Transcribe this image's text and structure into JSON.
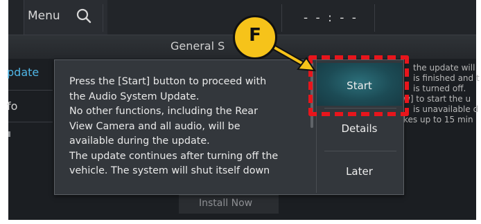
{
  "topbar": {
    "menu_label": "Menu",
    "clock": "- - : - -"
  },
  "subheader": {
    "title": "General S"
  },
  "sidebar": {
    "items": [
      {
        "label": "pdate"
      },
      {
        "label": "fo"
      }
    ]
  },
  "background_text": [
    "the update will",
    "is finished and t",
    "is turned off.",
    "w] to start the u",
    "is unavailable d",
    "kes up to 15 min"
  ],
  "install_button": {
    "label": "Install Now"
  },
  "dialog": {
    "message": "Press the [Start] button to proceed with\nthe Audio System Update.\nNo other functions, including the Rear\nView Camera and all audio, will be\navailable during the update.\nThe update continues after turning off the\nvehicle. The system will shut itself down",
    "buttons": {
      "start": "Start",
      "details": "Details",
      "later": "Later"
    }
  },
  "callout": {
    "label": "F",
    "color": "#e8151c",
    "badge_color": "#f6c31a"
  }
}
